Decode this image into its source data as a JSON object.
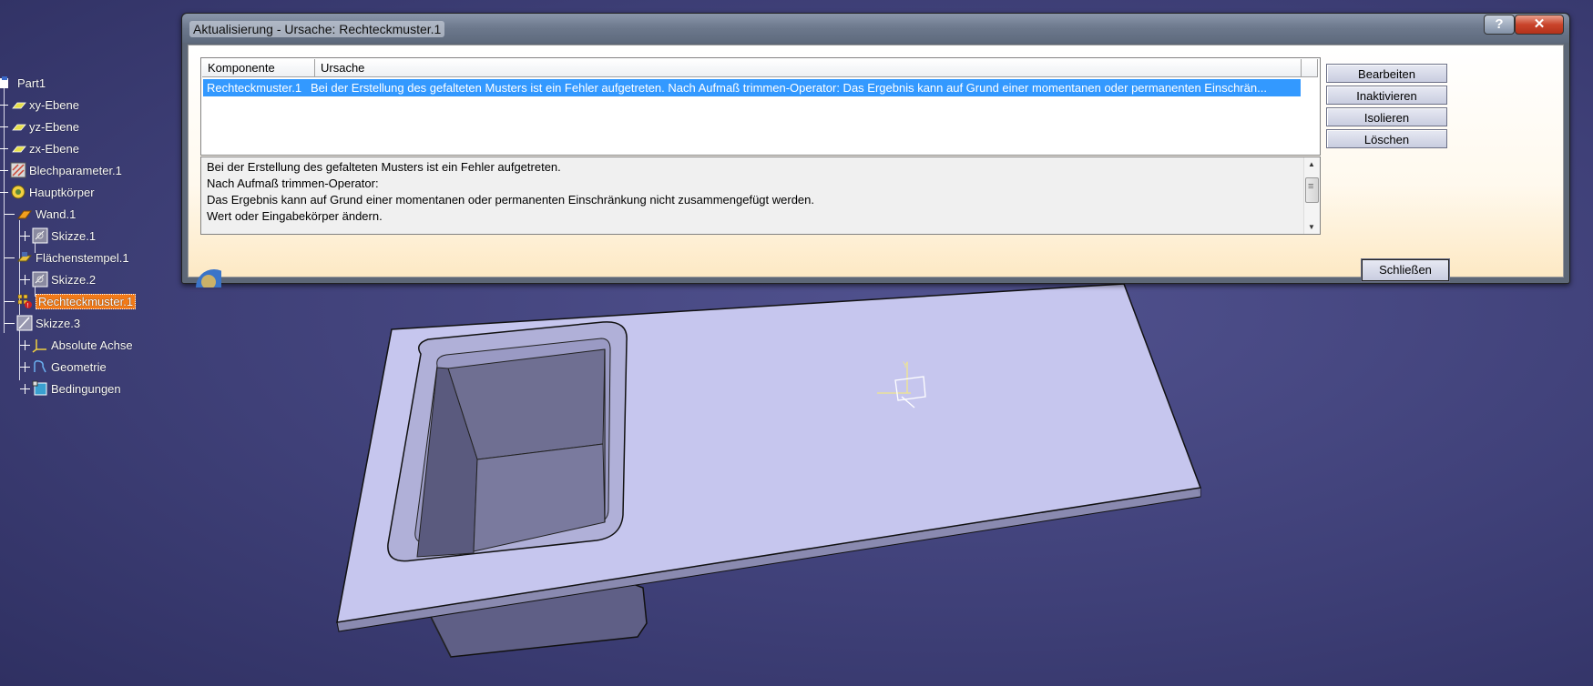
{
  "tree": {
    "items": [
      {
        "label": "Part1",
        "icon": "part-icon"
      },
      {
        "label": "xy-Ebene",
        "icon": "plane-icon"
      },
      {
        "label": "yz-Ebene",
        "icon": "plane-icon"
      },
      {
        "label": "zx-Ebene",
        "icon": "plane-icon"
      },
      {
        "label": "Blechparameter.1",
        "icon": "sheetmetal-parameters-icon"
      },
      {
        "label": "Hauptkörper",
        "icon": "body-icon"
      },
      {
        "label": "Wand.1",
        "icon": "wall-icon"
      },
      {
        "label": "Skizze.1",
        "icon": "sketch-icon"
      },
      {
        "label": "Flächenstempel.1",
        "icon": "surface-stamp-icon"
      },
      {
        "label": "Skizze.2",
        "icon": "sketch-icon"
      },
      {
        "label": "Rechteckmuster.1",
        "icon": "rectangular-pattern-icon"
      },
      {
        "label": "Skizze.3",
        "icon": "sketch-icon"
      },
      {
        "label": "Absolute Achse",
        "icon": "axis-system-icon"
      },
      {
        "label": "Geometrie",
        "icon": "geometry-icon"
      },
      {
        "label": "Bedingungen",
        "icon": "constraints-icon"
      }
    ]
  },
  "dialog": {
    "title": "Aktualisierung - Ursache: Rechteckmuster.1",
    "help_label": "?",
    "close_label": "✕",
    "columns": [
      "Komponente",
      "Ursache"
    ],
    "rows": [
      {
        "component": "Rechteckmuster.1",
        "cause": "Bei der Erstellung des gefalteten Musters ist ein Fehler aufgetreten. Nach Aufmaß trimmen-Operator: Das Ergebnis kann auf Grund einer momentanen oder permanenten Einschrän..."
      }
    ],
    "details": [
      "Bei der Erstellung des gefalteten Musters ist ein Fehler aufgetreten.",
      "Nach Aufmaß trimmen-Operator:",
      "Das Ergebnis kann auf Grund einer momentanen oder permanenten Einschränkung nicht zusammengefügt werden.",
      "Wert oder Eingabekörper ändern."
    ],
    "buttons": {
      "edit": "Bearbeiten",
      "deactivate": "Inaktivieren",
      "isolate": "Isolieren",
      "delete": "Löschen",
      "close": "Schließen"
    }
  },
  "colors": {
    "background": "#3f4078",
    "part_face": "#c7c7ee",
    "selection": "#3399ff",
    "highlight": "#f27a18"
  }
}
